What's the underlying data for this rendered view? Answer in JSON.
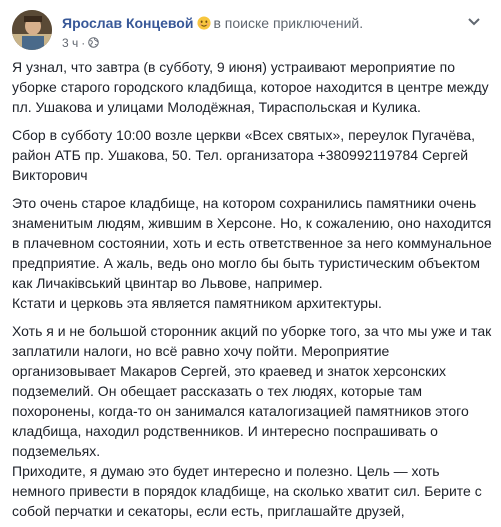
{
  "post": {
    "author": "Ярослав Концевой",
    "feeling_text": "в поиске приключений.",
    "feeling_icon": "smiling-face-emoji-icon",
    "timestamp": "3 ч",
    "separator": "·",
    "privacy_icon": "globe-icon",
    "menu_icon": "chevron-down-icon",
    "paragraphs": [
      "Я узнал, что завтра (в субботу, 9 июня) устраивают мероприятие по уборке старого городского кладбища, которое находится в центре между пл. Ушакова и улицами Молодёжная, Тираспольская и Кулика.",
      "Сбор в субботу 10:00 возле церкви «Всех святых», переулок Пугачёва, район АТБ пр. Ушакова, 50. Тел. организатора +380992119784 Сергей Викторович",
      "Это очень старое кладбище, на котором сохранились памятники очень знаменитым людям, жившим в Херсоне. Но, к сожалению, оно находится в плачевном состоянии, хоть и есть ответственное за него коммунальное предприятие. А жаль, ведь оно могло бы быть туристическим объектом как Личаківський цвинтар во Львове, например.",
      "Кстати и церковь эта является памятником архитектуры.",
      "Хоть я и не большой сторонник акций по уборке того, за что мы уже и так заплатили налоги, но всё равно хочу пойти. Мероприятие организовывает Макаров Сергей, это краевед и знаток херсонских подземелий. Он обещает рассказать о тех людях, которые там похоронены, когда-то он занимался каталогизацией памятников этого кладбища, находил родственников. И интересно поспрашивать о подземельях.",
      "Приходите, я думаю это будет интересно и полезно. Цель — хоть немного привести в порядок кладбище, на сколько хватит сил. Берите с собой перчатки и секаторы, если есть, приглашайте друзей,"
    ]
  },
  "colors": {
    "author_link": "#385898",
    "text": "#1d2129",
    "meta": "#616770",
    "background": "#ffffff"
  }
}
